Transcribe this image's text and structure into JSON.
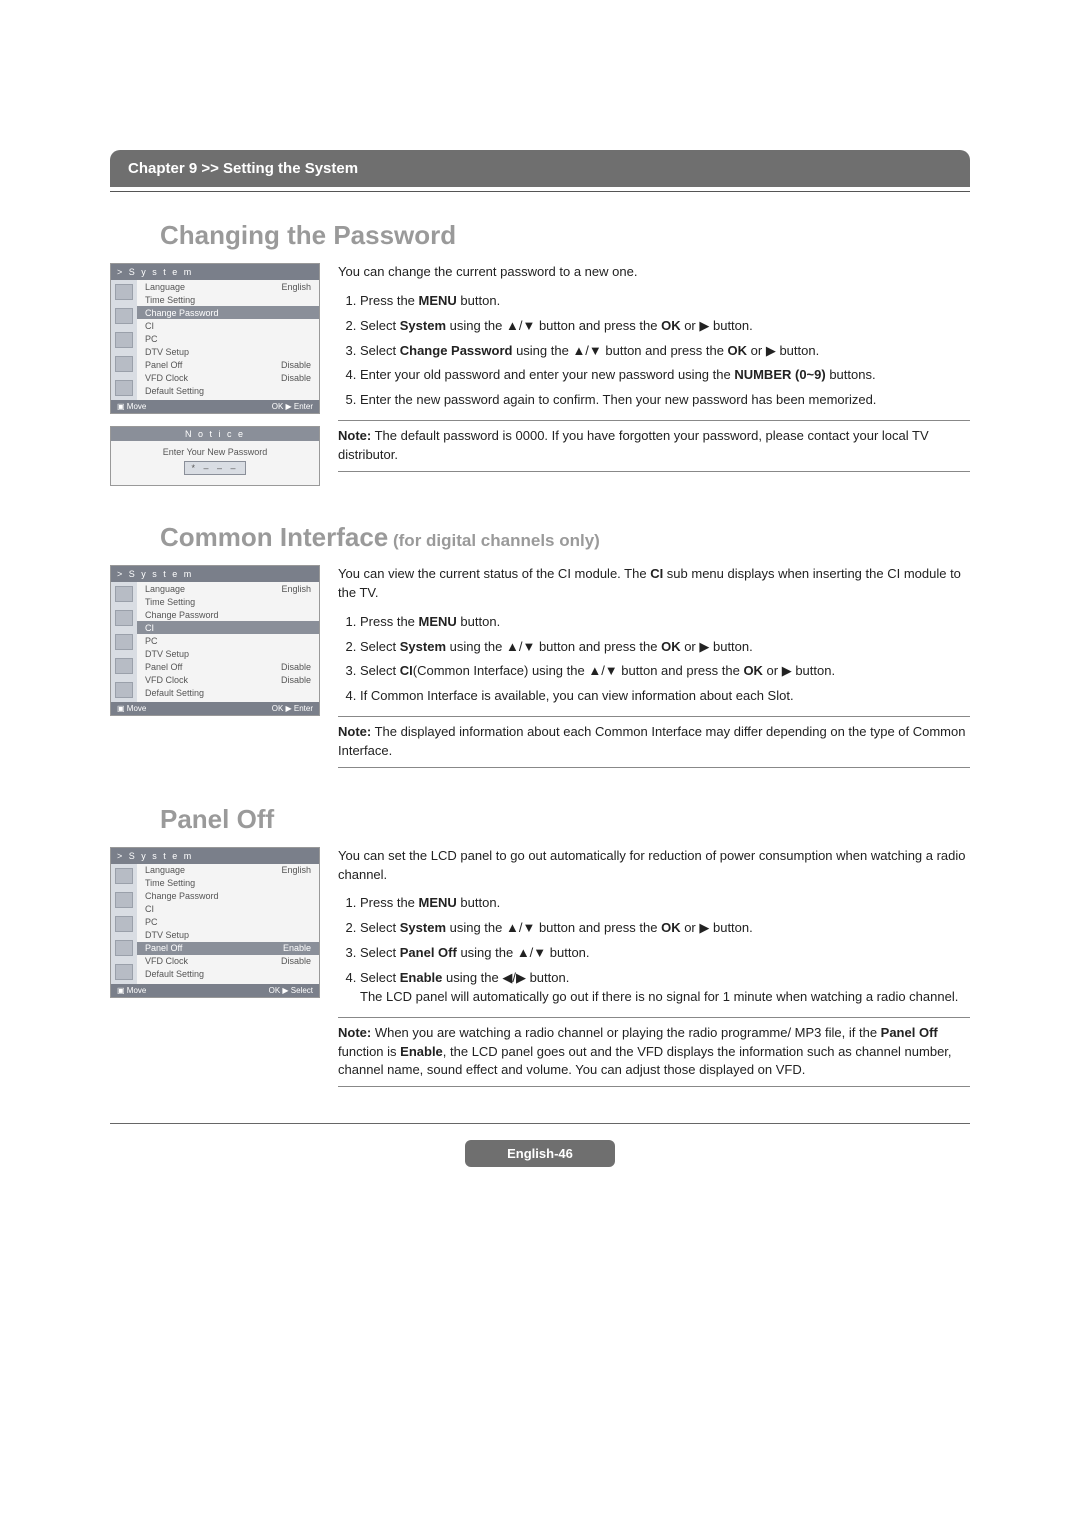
{
  "chapter_bar": "Chapter 9 >> Setting the System",
  "sec1": {
    "title": "Changing the Password",
    "intro": "You can change the current password to a new one.",
    "steps_html": [
      "Press the <b>MENU</b> button.",
      "Select <b>System</b> using the ▲/▼ button and press the <b>OK</b> or ▶ button.",
      "Select <b>Change Password</b> using the ▲/▼ button and press the <b>OK</b> or ▶ button.",
      "Enter your old password and enter your new password using the <b>NUMBER (0~9)</b> buttons.",
      "Enter the new password again to confirm. Then your new password has been memorized."
    ],
    "note_html": "<b>Note:</b> The default password is 0000. If you have forgotten your password, please contact your local TV distributor.",
    "osd": {
      "head": "> S y s t e m",
      "rows": [
        {
          "l": "Language",
          "r": "English",
          "hl": false
        },
        {
          "l": "Time Setting",
          "r": "",
          "hl": false
        },
        {
          "l": "Change Password",
          "r": "",
          "hl": true
        },
        {
          "l": "CI",
          "r": "",
          "hl": false
        },
        {
          "l": "PC",
          "r": "",
          "hl": false
        },
        {
          "l": "DTV Setup",
          "r": "",
          "hl": false
        },
        {
          "l": "Panel Off",
          "r": "Disable",
          "hl": false
        },
        {
          "l": "VFD Clock",
          "r": "Disable",
          "hl": false
        },
        {
          "l": "Default Setting",
          "r": "",
          "hl": false
        }
      ],
      "foot_l": "▣ Move",
      "foot_r": "OK ▶ Enter"
    },
    "notice": {
      "title": "N o t i c e",
      "line": "Enter Your New Password",
      "field": "* – – –"
    }
  },
  "sec2": {
    "title": "Common Interface",
    "subtitle": " (for digital channels only)",
    "intro": "You can view the current status of the CI module. The CI sub menu displays when inserting the CI module to the TV.",
    "intro_html": "You can view the current status of the CI module. The <b>CI</b> sub menu displays when inserting the CI module to the TV.",
    "steps_html": [
      "Press the <b>MENU</b> button.",
      "Select <b>System</b> using the ▲/▼ button and press the <b>OK</b> or ▶ button.",
      "Select <b>CI</b>(Common Interface) using the ▲/▼ button and press the <b>OK</b> or ▶ button.",
      "If Common Interface is available, you can view information about each Slot."
    ],
    "note_html": "<b>Note:</b> The displayed information about each Common Interface may differ depending on the type of Common Interface.",
    "osd": {
      "head": "> S y s t e m",
      "rows": [
        {
          "l": "Language",
          "r": "English",
          "hl": false
        },
        {
          "l": "Time Setting",
          "r": "",
          "hl": false
        },
        {
          "l": "Change Password",
          "r": "",
          "hl": false
        },
        {
          "l": "CI",
          "r": "",
          "hl": true
        },
        {
          "l": "PC",
          "r": "",
          "hl": false
        },
        {
          "l": "DTV Setup",
          "r": "",
          "hl": false
        },
        {
          "l": "Panel Off",
          "r": "Disable",
          "hl": false
        },
        {
          "l": "VFD Clock",
          "r": "Disable",
          "hl": false
        },
        {
          "l": "Default Setting",
          "r": "",
          "hl": false
        }
      ],
      "foot_l": "▣ Move",
      "foot_r": "OK ▶ Enter"
    }
  },
  "sec3": {
    "title": "Panel Off",
    "intro": "You can set the LCD panel to go out automatically for reduction of power consumption when watching a radio channel.",
    "steps_html": [
      "Press the <b>MENU</b> button.",
      "Select <b>System</b> using the ▲/▼ button and press the <b>OK</b> or ▶ button.",
      "Select <b>Panel Off</b> using the ▲/▼ button.",
      "Select <b>Enable</b> using the ◀/▶ button.<br>The LCD panel will automatically go out if there is no signal for 1 minute when watching a radio channel."
    ],
    "note_html": "<b>Note:</b> When you are watching a radio channel or playing the radio programme/ MP3 file, if the <b>Panel Off</b> function is <b>Enable</b>, the LCD panel goes out and the VFD displays the information such as channel number, channel name, sound effect and volume. You can adjust those displayed on VFD.",
    "osd": {
      "head": "> S y s t e m",
      "rows": [
        {
          "l": "Language",
          "r": "English",
          "hl": false
        },
        {
          "l": "Time Setting",
          "r": "",
          "hl": false
        },
        {
          "l": "Change Password",
          "r": "",
          "hl": false
        },
        {
          "l": "CI",
          "r": "",
          "hl": false
        },
        {
          "l": "PC",
          "r": "",
          "hl": false
        },
        {
          "l": "DTV Setup",
          "r": "",
          "hl": false
        },
        {
          "l": "Panel Off",
          "r": "Enable",
          "hl": true
        },
        {
          "l": "VFD Clock",
          "r": "Disable",
          "hl": false
        },
        {
          "l": "Default Setting",
          "r": "",
          "hl": false
        }
      ],
      "foot_l": "▣ Move",
      "foot_r": "OK ▶ Select"
    }
  },
  "page_foot": "English-46"
}
